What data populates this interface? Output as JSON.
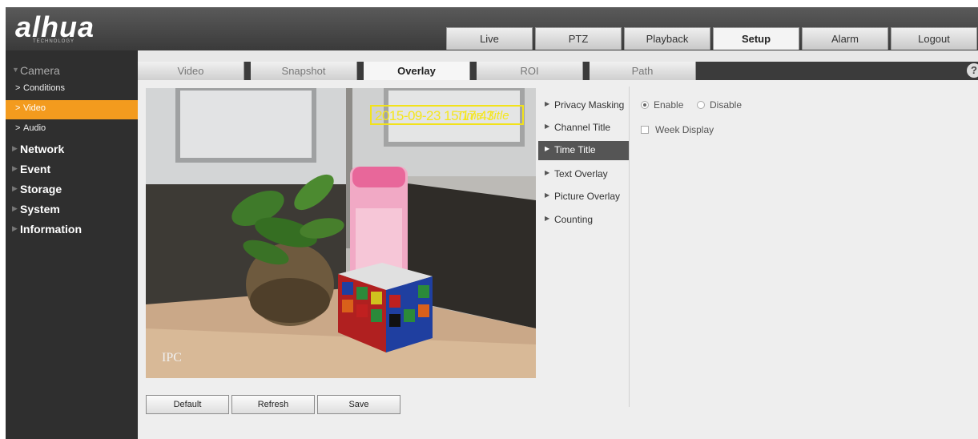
{
  "header": {
    "logo": "alhua",
    "logo_sub": "TECHNOLOGY",
    "nav": [
      "Live",
      "PTZ",
      "Playback",
      "Setup",
      "Alarm",
      "Logout"
    ],
    "active_nav": "Setup"
  },
  "sidebar": {
    "camera": "Camera",
    "conditions": "Conditions",
    "video": "Video",
    "audio": "Audio",
    "network": "Network",
    "event": "Event",
    "storage": "Storage",
    "system": "System",
    "information": "Information",
    "active": "Video"
  },
  "subtabs": [
    "Video",
    "Snapshot",
    "Overlay",
    "ROI",
    "Path"
  ],
  "active_subtab": "Overlay",
  "help": "?",
  "video": {
    "osd_datetime": "2015-09-23 15:17:43",
    "osd_label": "Time Title",
    "channel_name": "IPC"
  },
  "buttons": {
    "default": "Default",
    "refresh": "Refresh",
    "save": "Save"
  },
  "overlay_menu": [
    "Privacy Masking",
    "Channel Title",
    "Time Title",
    "Text Overlay",
    "Picture Overlay",
    "Counting"
  ],
  "active_menu": "Time Title",
  "options": {
    "enable": "Enable",
    "disable": "Disable",
    "selected": "Enable",
    "week_display": "Week Display",
    "week_display_checked": false
  },
  "colors": {
    "accent": "#f39b1e",
    "osd": "#f5e61d"
  }
}
